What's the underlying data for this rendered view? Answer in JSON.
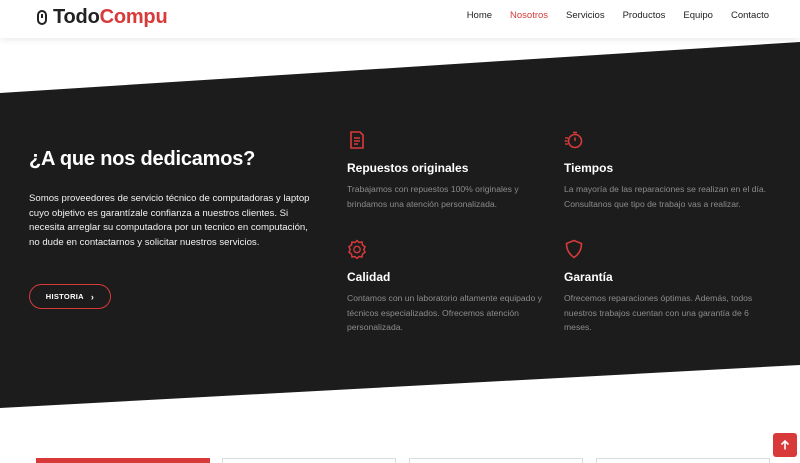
{
  "brand": {
    "part1": "Todo",
    "part2": "Compu"
  },
  "nav": [
    "Home",
    "Nosotros",
    "Servicios",
    "Productos",
    "Equipo",
    "Contacto"
  ],
  "nav_active": "Nosotros",
  "about": {
    "title": "¿A que nos dedicamos?",
    "text": "Somos proveedores de servicio técnico de computadoras y laptop cuyo objetivo es garantízale confianza a nuestros clientes. Si necesita arreglar su computadora por un tecnico en computación, no dude en contactarnos y solicitar nuestros servicios.",
    "button": "HISTORIA"
  },
  "features": [
    {
      "icon": "document-icon",
      "title": "Repuestos originales",
      "text": "Trabajamos con repuestos 100% originales y brindamos una atención personalizada."
    },
    {
      "icon": "stopwatch-icon",
      "title": "Tiempos",
      "text": "La mayoría de las reparaciones se realizan en el día. Consultanos que tipo de trabajo vas a realizar."
    },
    {
      "icon": "badge-icon",
      "title": "Calidad",
      "text": "Contamos con un laboratorio altamente equipado y técnicos especializados. Ofrecemos atención personalizada."
    },
    {
      "icon": "shield-icon",
      "title": "Garantía",
      "text": "Ofrecemos reparaciones óptimas. Además, todos nuestros trabajos cuentan con una garantía de 6 meses."
    }
  ],
  "colors": {
    "accent": "#d83a3a",
    "dark": "#1c1c1c",
    "muted_text": "#8c8c8c"
  }
}
